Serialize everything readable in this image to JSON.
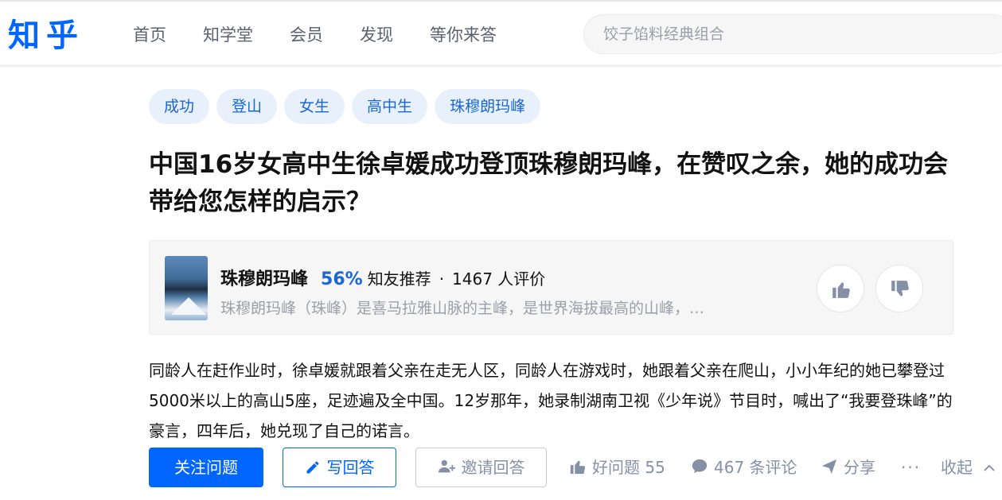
{
  "header": {
    "logo": "知乎",
    "nav": [
      "首页",
      "知学堂",
      "会员",
      "发现",
      "等你来答"
    ],
    "search_placeholder": "饺子馅料经典组合"
  },
  "topics": [
    "成功",
    "登山",
    "女生",
    "高中生",
    "珠穆朗玛峰"
  ],
  "question": {
    "title": "中国16岁女高中生徐卓媛成功登顶珠穆朗玛峰，在赞叹之余，她的成功会带给您怎样的启示？",
    "body": "同龄人在赶作业时，徐卓媛就跟着父亲在走无人区，同龄人在游戏时，她跟着父亲在爬山，小小年纪的她已攀登过5000米以上的高山5座，足迹遍及全中国。12岁那年，她录制湖南卫视《少年说》节目时，喊出了“我要登珠峰”的豪言，四年后，她兑现了自己的诺言。"
  },
  "card": {
    "name": "珠穆朗玛峰",
    "percent": "56%",
    "recommend_label": "知友推荐",
    "dot": "·",
    "review_count": "1467 人评价",
    "description": "珠穆朗玛峰（珠峰）是喜马拉雅山脉的主峰，是世界海拔最高的山峰，…"
  },
  "actions": {
    "follow": "关注问题",
    "write": "写回答",
    "invite": "邀请回答",
    "good_question": "好问题 55",
    "comments": "467 条评论",
    "share": "分享",
    "more": "···",
    "collapse": "收起"
  },
  "colors": {
    "brand": "#0066ff",
    "topic_bg": "#e8f1fb",
    "topic_text": "#1a66d6",
    "meta_text": "#8590a6"
  }
}
